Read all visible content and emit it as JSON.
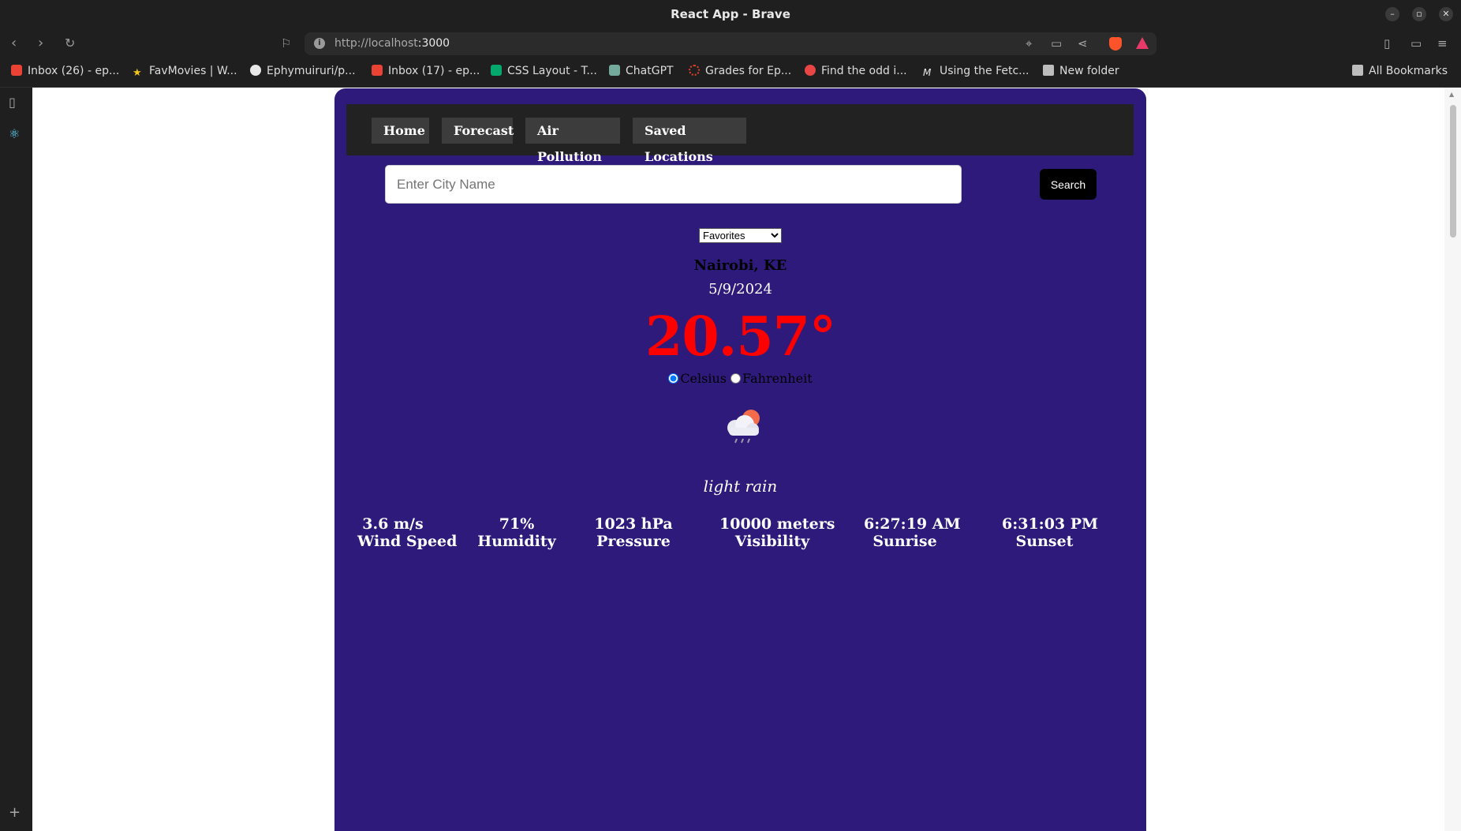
{
  "window": {
    "title": "React App - Brave"
  },
  "toolbar": {
    "url_host": "http://localhost",
    "url_port": ":3000"
  },
  "bookmarks": [
    {
      "label": "Inbox (26) - ep...",
      "icon": "gmail-icon",
      "color": "#ea4335"
    },
    {
      "label": "FavMovies | W...",
      "icon": "star-icon",
      "color": "#f5c518"
    },
    {
      "label": "Ephymuiruri/p...",
      "icon": "github-icon",
      "color": "#e8e8e8"
    },
    {
      "label": "Inbox (17) - ep...",
      "icon": "gmail-icon",
      "color": "#ea4335"
    },
    {
      "label": "CSS Layout - T...",
      "icon": "w3-icon",
      "color": "#04aa6d"
    },
    {
      "label": "ChatGPT",
      "icon": "chatgpt-icon",
      "color": "#74aa9c"
    },
    {
      "label": "Grades for Ep...",
      "icon": "canvas-icon",
      "color": "#e13f2b"
    },
    {
      "label": "Find the odd i...",
      "icon": "hexagon-icon",
      "color": "#e84545"
    },
    {
      "label": "Using the Fetc...",
      "icon": "mdn-icon",
      "color": "#e8e8e8"
    },
    {
      "label": "New folder",
      "icon": "folder-icon",
      "color": "#bdbdbd"
    }
  ],
  "all_bookmarks": "All Bookmarks",
  "nav": [
    "Home",
    "Forecast",
    "Air Pollution",
    "Saved Locations"
  ],
  "search": {
    "placeholder": "Enter City Name",
    "button": "Search"
  },
  "favorites": {
    "selected": "Favorites"
  },
  "weather": {
    "city": "Nairobi, KE",
    "date": "5/9/2024",
    "temperature": "20.57°",
    "unit_celsius": "Celsius",
    "unit_fahrenheit": "Fahrenheit",
    "description": "light rain"
  },
  "stats": [
    {
      "value": "3.6 m/s",
      "label": "Wind Speed"
    },
    {
      "value": "71%",
      "label": "Humidity"
    },
    {
      "value": "1023 hPa",
      "label": "Pressure"
    },
    {
      "value": "10000 meters",
      "label": "Visibility"
    },
    {
      "value": "6:27:19 AM",
      "label": "Sunrise"
    },
    {
      "value": "6:31:03 PM",
      "label": "Sunset"
    }
  ],
  "colors": {
    "app_bg": "#2e1a7a",
    "temperature": "#ff0000",
    "nav_bg": "#222222"
  }
}
